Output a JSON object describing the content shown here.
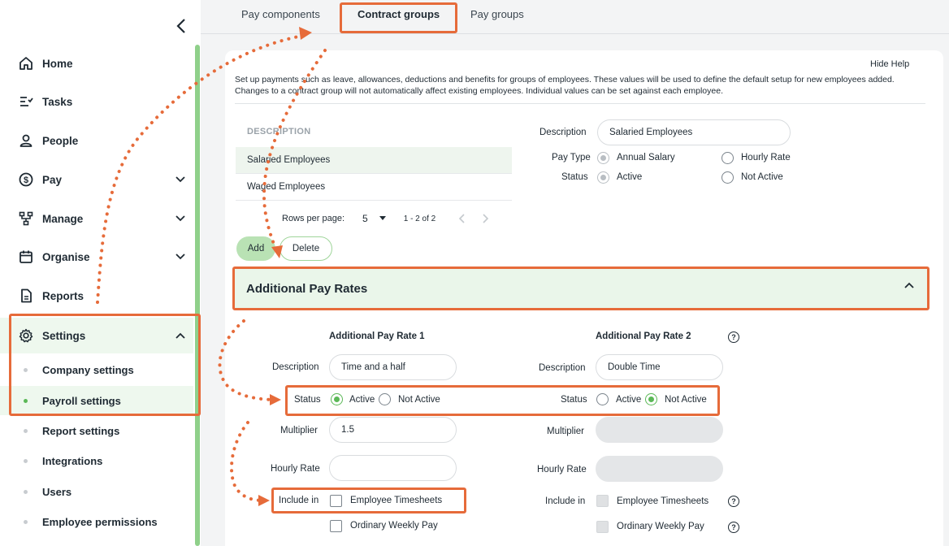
{
  "sidebar": {
    "items": [
      {
        "label": "Home",
        "icon": "home-icon"
      },
      {
        "label": "Tasks",
        "icon": "tasks-icon"
      },
      {
        "label": "People",
        "icon": "person-icon"
      },
      {
        "label": "Pay",
        "icon": "dollar-icon"
      },
      {
        "label": "Manage",
        "icon": "hierarchy-icon"
      },
      {
        "label": "Organise",
        "icon": "calendar-icon"
      },
      {
        "label": "Reports",
        "icon": "document-icon"
      },
      {
        "label": "Settings",
        "icon": "gear-icon"
      }
    ],
    "settings_subitems": [
      {
        "label": "Company settings"
      },
      {
        "label": "Payroll settings"
      },
      {
        "label": "Report settings"
      },
      {
        "label": "Integrations"
      },
      {
        "label": "Users"
      },
      {
        "label": "Employee permissions"
      }
    ]
  },
  "tabs": [
    {
      "label": "Pay components"
    },
    {
      "label": "Contract groups"
    },
    {
      "label": "Pay groups"
    }
  ],
  "help": {
    "hide_label": "Hide Help",
    "text": "Set up payments such as leave, allowances, deductions and benefits for groups of employees. These values will be used to define the default setup for new employees added. Changes to a contract group will not automatically affect existing employees. Individual values can be set against each employee."
  },
  "list": {
    "header": "DESCRIPTION",
    "rows": [
      "Salaried Employees",
      "Waged Employees"
    ],
    "rows_per_page_label": "Rows per page:",
    "rows_per_page": "5",
    "range": "1 - 2 of 2"
  },
  "buttons": {
    "add": "Add",
    "delete": "Delete"
  },
  "group_form": {
    "description_label": "Description",
    "description_value": "Salaried Employees",
    "pay_type_label": "Pay Type",
    "pay_type_options": [
      "Annual Salary",
      "Hourly Rate"
    ],
    "status_label": "Status",
    "status_options": [
      "Active",
      "Not Active"
    ]
  },
  "additional_pay": {
    "section_title": "Additional Pay Rates",
    "rate1": {
      "heading": "Additional Pay Rate 1",
      "description_label": "Description",
      "description_value": "Time and a half",
      "status_label": "Status",
      "active_label": "Active",
      "not_active_label": "Not Active",
      "multiplier_label": "Multiplier",
      "multiplier_value": "1.5",
      "hourly_rate_label": "Hourly Rate",
      "hourly_rate_value": "",
      "include_label": "Include in",
      "include_options": [
        "Employee Timesheets",
        "Ordinary Weekly Pay"
      ]
    },
    "rate2": {
      "heading": "Additional Pay Rate 2",
      "description_label": "Description",
      "description_value": "Double Time",
      "status_label": "Status",
      "active_label": "Active",
      "not_active_label": "Not Active",
      "multiplier_label": "Multiplier",
      "hourly_rate_label": "Hourly Rate",
      "include_label": "Include in",
      "include_options": [
        "Employee Timesheets",
        "Ordinary Weekly Pay"
      ]
    }
  },
  "colors": {
    "accent": "#5bb857",
    "highlight": "#e66b3a",
    "selected_bg": "#eef8ee"
  }
}
